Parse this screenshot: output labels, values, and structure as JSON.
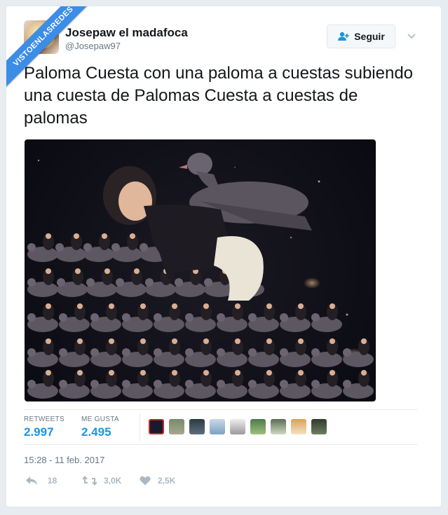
{
  "watermark": {
    "text": "VISTOENLASREDES"
  },
  "user": {
    "name": "Josepaw el madafoca",
    "handle": "@Josepaw97"
  },
  "follow_button": {
    "label": "Seguir",
    "icon": "add-user-icon"
  },
  "tweet": {
    "text": "Paloma Cuesta con una paloma a cuestas subiendo una cuesta de Palomas Cuesta a cuestas de palomas",
    "timestamp": "15:28 - 11 feb. 2017"
  },
  "photo": {
    "description_icon": "photo-collage"
  },
  "stats": {
    "retweets_label": "RETWEETS",
    "retweets_value": "2.997",
    "likes_label": "ME GUSTA",
    "likes_value": "2.495"
  },
  "actions": {
    "reply_count": "18",
    "retweet_count": "3,0K",
    "like_count": "2,5K"
  },
  "colors": {
    "accent": "#1b95e0",
    "watermark": "#3b8de6",
    "muted": "#657786",
    "icon_gray": "#aab8c2"
  }
}
